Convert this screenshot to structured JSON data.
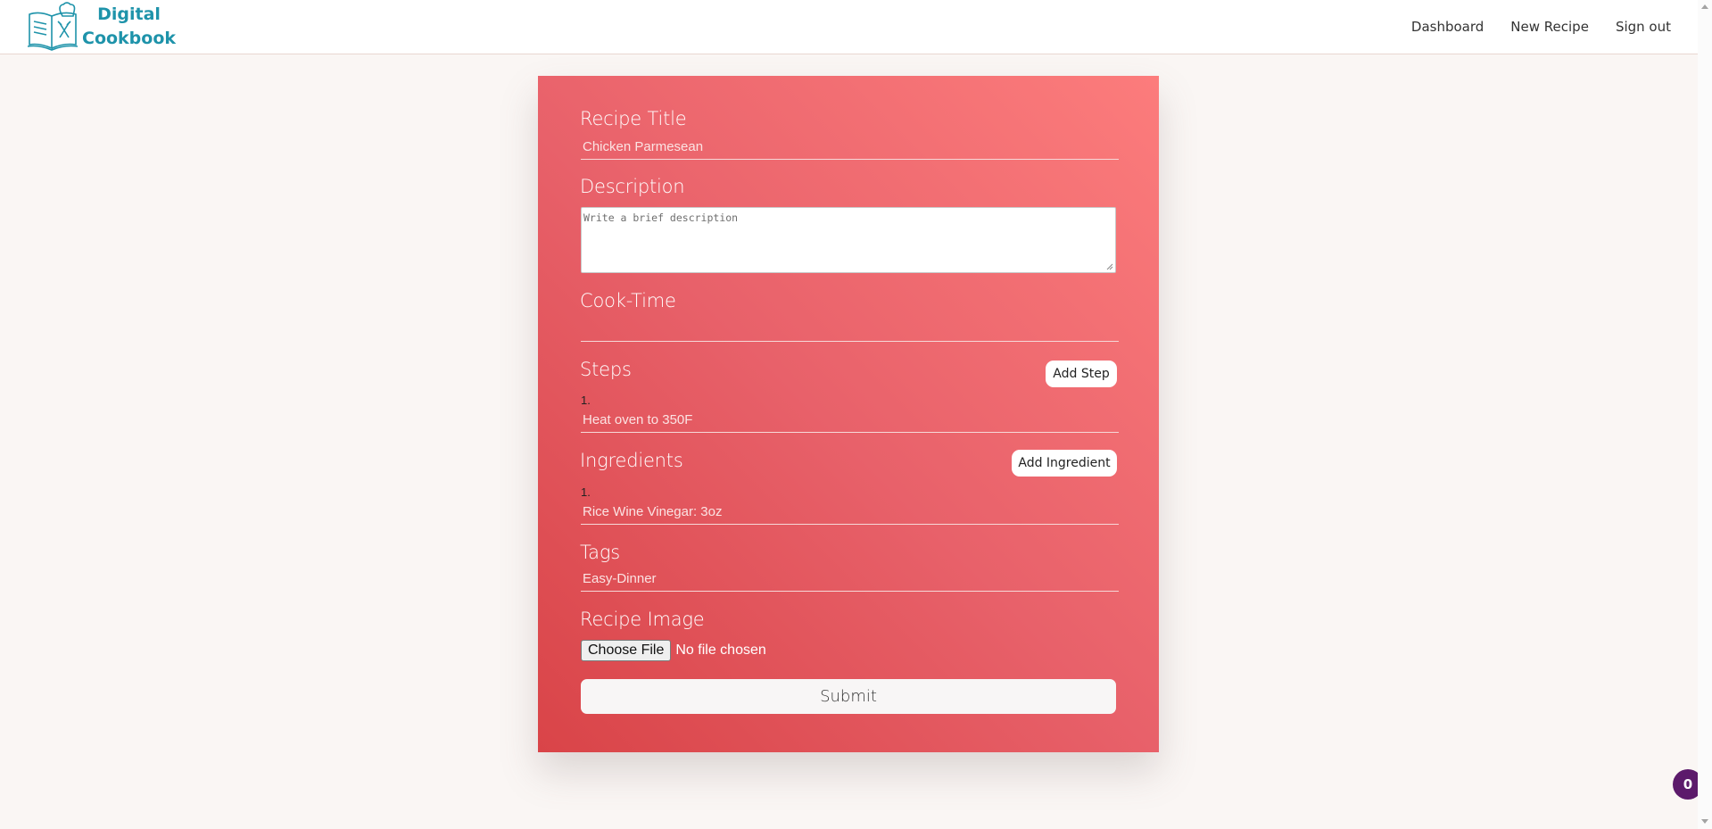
{
  "navbar": {
    "brand_line1": "Digital",
    "brand_line2": "Cookbook",
    "links": [
      "Dashboard",
      "New Recipe",
      "Sign out"
    ]
  },
  "form": {
    "title_label": "Recipe Title",
    "title_value": "Chicken Parmesean",
    "description_label": "Description",
    "description_placeholder": "Write a brief description",
    "cooktime_label": "Cook-Time",
    "cooktime_value": "",
    "steps_label": "Steps",
    "add_step_label": "Add Step",
    "steps": [
      {
        "number": "1.",
        "value": "Heat oven to 350F"
      }
    ],
    "ingredients_label": "Ingredients",
    "add_ingredient_label": "Add Ingredient",
    "ingredients": [
      {
        "number": "1.",
        "value": "Rice Wine Vinegar: 3oz"
      }
    ],
    "tags_label": "Tags",
    "tags_value": "Easy-Dinner",
    "image_label": "Recipe Image",
    "choose_file_label": "Choose File",
    "file_status": "No file chosen",
    "submit_label": "Submit"
  },
  "badge": {
    "count": "0"
  },
  "colors": {
    "brand": "#1e93aa",
    "card_gradient_start": "#d94448",
    "card_gradient_end": "#fc7c7c",
    "badge": "#5c1a6b",
    "page_background": "#faf6f4"
  },
  "icons": [
    "cookbook-logo-icon",
    "textarea-resize-icon",
    "scroll-up-icon",
    "scroll-down-icon"
  ]
}
